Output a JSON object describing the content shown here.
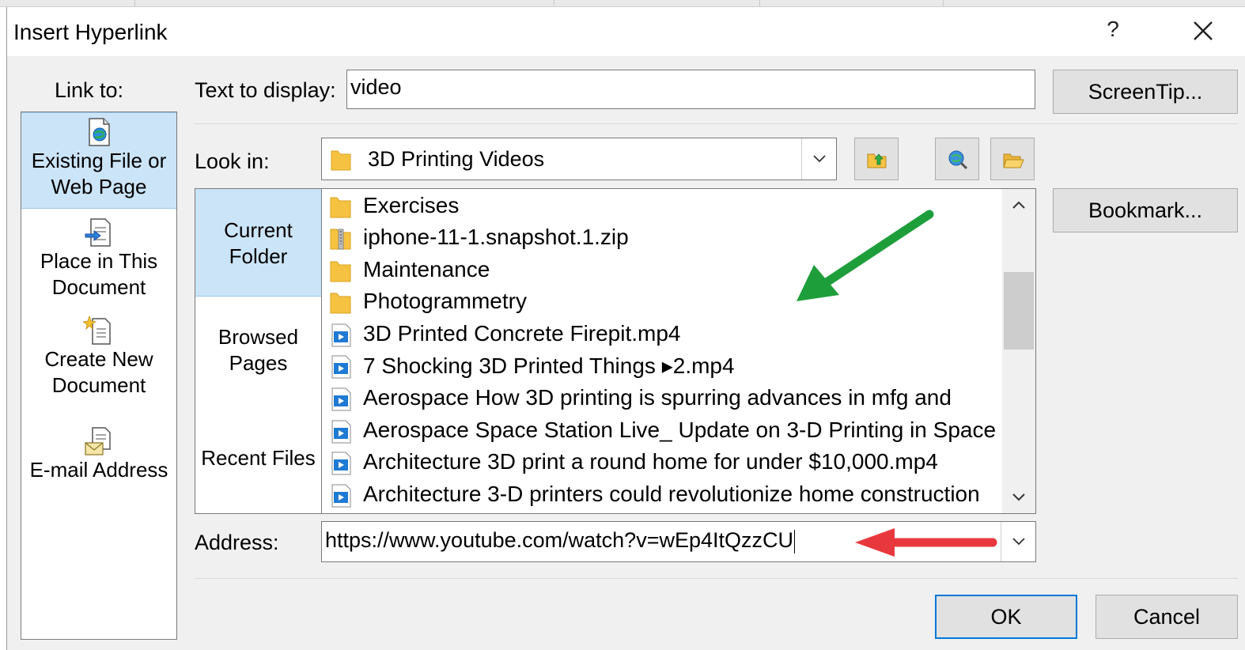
{
  "dialog": {
    "title": "Insert Hyperlink",
    "help_label": "?"
  },
  "link_to": {
    "label": "Link to:",
    "items": [
      {
        "line1": "Existing File or",
        "line2": "Web Page",
        "icon": "existing-file-icon",
        "selected": true
      },
      {
        "line1": "Place in This",
        "line2": "Document",
        "icon": "place-in-document-icon",
        "selected": false
      },
      {
        "line1": "Create New",
        "line2": "Document",
        "icon": "new-document-icon",
        "selected": false
      },
      {
        "line1": "E-mail Address",
        "line2": "",
        "icon": "email-icon",
        "selected": false
      }
    ]
  },
  "text_to_display": {
    "label": "Text to display:",
    "value": "video"
  },
  "screentip_button": "ScreenTip...",
  "bookmark_button": "Bookmark...",
  "look_in": {
    "label": "Look in:",
    "value": "3D Printing Videos",
    "tool_icons": [
      "up-one-folder-icon",
      "browse-web-icon",
      "browse-file-icon"
    ]
  },
  "nav": {
    "items": [
      {
        "line1": "Current",
        "line2": "Folder",
        "selected": true
      },
      {
        "line1": "Browsed",
        "line2": "Pages",
        "selected": false
      },
      {
        "line1": "Recent Files",
        "line2": "",
        "selected": false
      }
    ]
  },
  "files": [
    {
      "name": "Exercises",
      "type": "folder"
    },
    {
      "name": "iphone-11-1.snapshot.1.zip",
      "type": "zip"
    },
    {
      "name": "Maintenance",
      "type": "folder"
    },
    {
      "name": "Photogrammetry",
      "type": "folder"
    },
    {
      "name": "3D Printed Concrete Firepit.mp4",
      "type": "video"
    },
    {
      "name": "7 Shocking 3D Printed Things ▸2.mp4",
      "type": "video"
    },
    {
      "name": "Aerospace How 3D printing is spurring advances in mfg and",
      "type": "video"
    },
    {
      "name": "Aerospace Space Station Live_ Update on 3-D Printing in Space",
      "type": "video"
    },
    {
      "name": "Architecture 3D print a round home for under $10,000.mp4",
      "type": "video"
    },
    {
      "name": "Architecture 3-D printers could revolutionize home construction",
      "type": "video"
    }
  ],
  "address": {
    "label": "Address:",
    "value": "https://www.youtube.com/watch?v=wEp4ItQzzCU"
  },
  "ok_button": "OK",
  "cancel_button": "Cancel",
  "colors": {
    "selection": "#cce4f7",
    "selection_border": "#99c9ef",
    "default_button_border": "#0078d7",
    "green_arrow": "#1e9e3a",
    "red_arrow": "#e8383d",
    "folder": "#f5c242",
    "video_icon": "#1f7ad4"
  }
}
